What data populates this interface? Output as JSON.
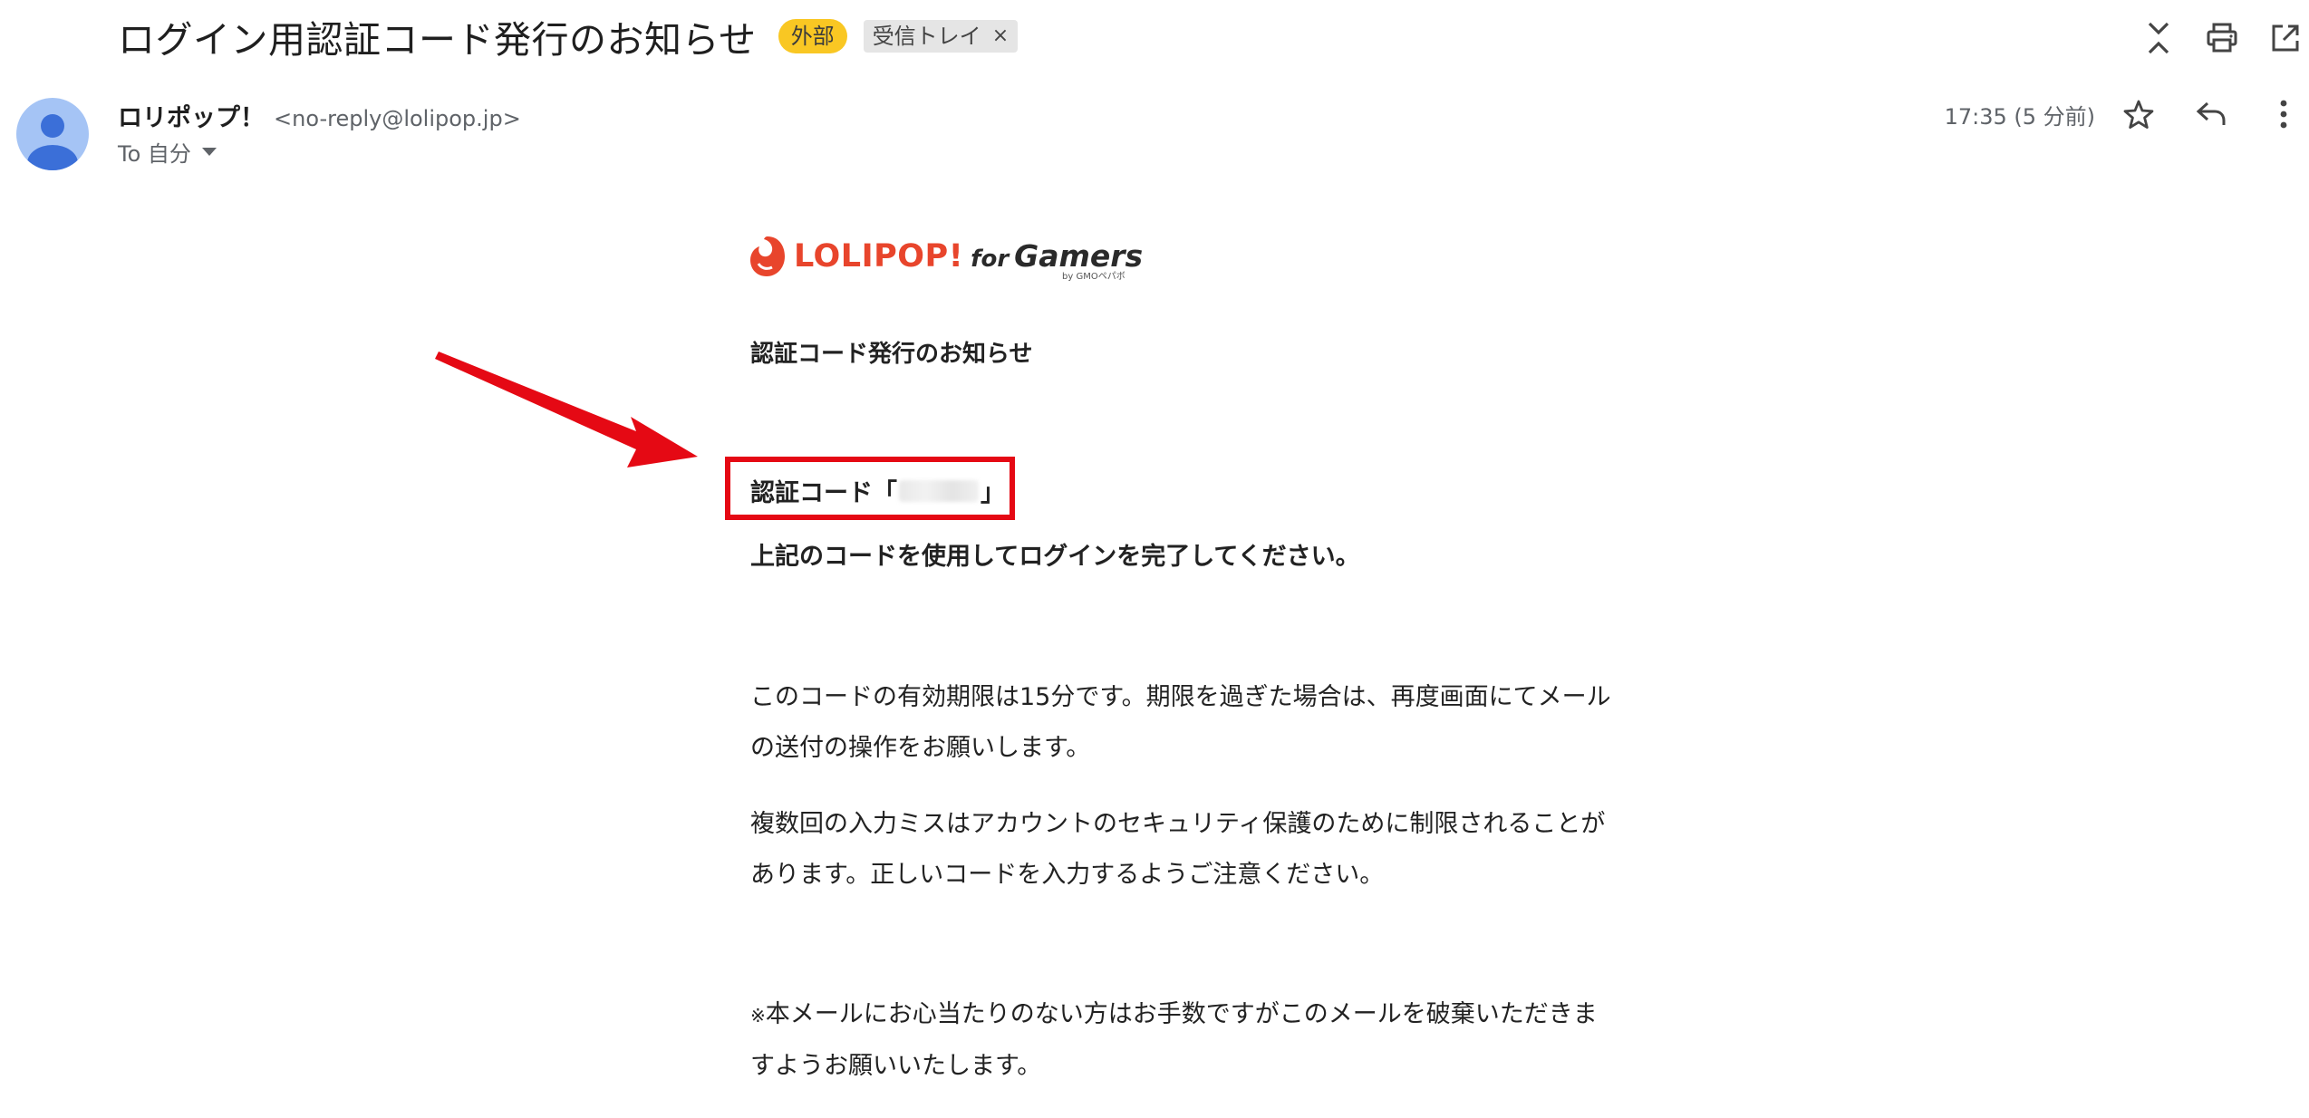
{
  "header": {
    "subject": "ログイン用認証コード発行のお知らせ",
    "labels": {
      "external": "外部",
      "inbox": "受信トレイ",
      "remove": "×"
    },
    "icons": [
      "expand-collapse-icon",
      "print-icon",
      "open-in-new-window-icon"
    ]
  },
  "sender": {
    "name": "ロリポップ！",
    "email": "<no-reply@lolipop.jp>",
    "to": "To 自分",
    "timestamp": "17:35 (5 分前)",
    "icons": [
      "star-icon",
      "reply-icon",
      "more-vert-icon"
    ]
  },
  "email": {
    "logo": {
      "lolipop": "LOLIPOP!",
      "for": "for",
      "gamers": "Gamers",
      "byline": "by GMOペパボ"
    },
    "heading": "認証コード発行のお知らせ",
    "code_prefix": "認証コード「",
    "code_suffix": "」",
    "instruction": "上記のコードを使用してログインを完了してください。",
    "para1_line1": "このコードの有効期限は15分です。期限を過ぎた場合は、再度画面にてメール",
    "para1_line2": "の送付の操作をお願いします。",
    "para2_line1": "複数回の入力ミスはアカウントのセキュリティ保護のために制限されることが",
    "para2_line2": "あります。正しいコードを入力するようご注意ください。",
    "para3_mark": "※",
    "para3_line1": "本メールにお心当たりのない方はお手数ですがこのメールを破棄いただきま",
    "para3_line2": "すようお願いいたします。"
  },
  "colors": {
    "highlight_box": "#e50914",
    "arrow": "#e50914",
    "external_label": "#f9c723",
    "logo_red": "#e8452c"
  }
}
